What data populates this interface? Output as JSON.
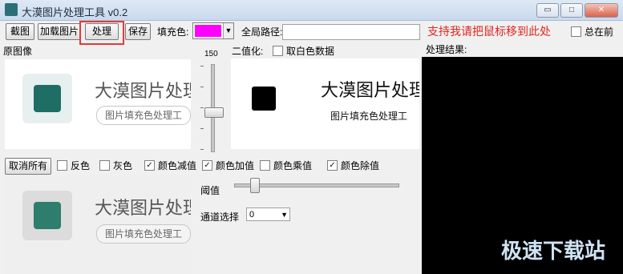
{
  "window": {
    "title": "大漠图片处理工具 v0.2",
    "controls": {
      "minimize": "▭",
      "maximize": "□",
      "close": "✕"
    }
  },
  "toolbar": {
    "screenshot_label": "截图",
    "load_image_label": "加载图片",
    "process_label": "处理",
    "save_label": "保存",
    "fill_color_label": "填充色:",
    "fill_color_value": "#ff00ff",
    "global_path_label": "全局路径:",
    "global_path_value": "",
    "support_text": "支持我请把鼠标移到此处",
    "always_on_top_label": "总在前"
  },
  "left": {
    "original_label": "原图像",
    "panel_title": "大漠图片处理",
    "panel_subtitle": "图片填充色处理工"
  },
  "middle": {
    "slider_value": "150",
    "binarize_label": "二值化:",
    "take_bw_label": "取白色数据",
    "preview_title": "大漠图片处理",
    "preview_subtitle": "图片填充色处理工",
    "threshold_label": "阈值",
    "channel_label": "通道选择",
    "channel_value": "0"
  },
  "right": {
    "result_label": "处理结果:",
    "watermark": "极速下载站"
  },
  "options": {
    "cancel_all_label": "取消所有",
    "invert_label": "反色",
    "gray_label": "灰色",
    "color_sub_label": "颜色减值",
    "color_add_label": "颜色加值",
    "color_mul_label": "颜色乘值",
    "color_div_label": "颜色除值"
  },
  "lower": {
    "panel_title": "大漠图片处理",
    "panel_subtitle": "图片填充色处理工"
  },
  "colors": {
    "accent": "#e0261f",
    "highlight": "#e23b3b",
    "fill_color": "#ff00ff"
  }
}
